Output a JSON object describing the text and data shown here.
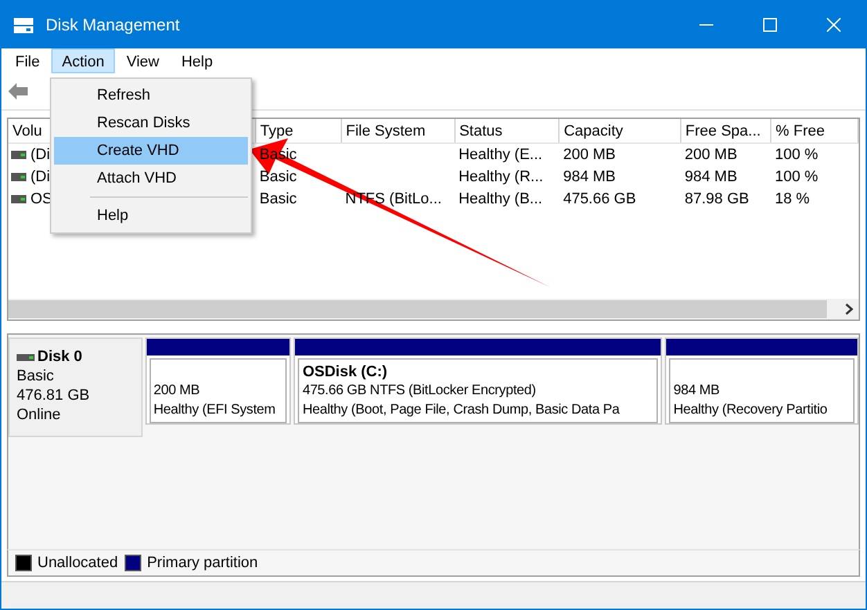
{
  "window": {
    "title": "Disk Management"
  },
  "menu_bar": [
    {
      "label": "File",
      "selected": false
    },
    {
      "label": "Action",
      "selected": true
    },
    {
      "label": "View",
      "selected": false
    },
    {
      "label": "Help",
      "selected": false
    }
  ],
  "dropdown": {
    "items": [
      {
        "label": "Refresh",
        "selected": false,
        "separator_before": false
      },
      {
        "label": "Rescan Disks",
        "selected": false,
        "separator_before": false
      },
      {
        "label": "Create VHD",
        "selected": true,
        "separator_before": false
      },
      {
        "label": "Attach VHD",
        "selected": false,
        "separator_before": false
      },
      {
        "label": "Help",
        "selected": false,
        "separator_before": true
      }
    ]
  },
  "table": {
    "columns": [
      "Volu",
      "",
      "Type",
      "File System",
      "Status",
      "Capacity",
      "Free Spa...",
      "% Free"
    ],
    "rows": [
      [
        "(Di",
        "",
        "Basic",
        "",
        "Healthy (E...",
        "200 MB",
        "200 MB",
        "100 %"
      ],
      [
        "(Di",
        "",
        "Basic",
        "",
        "Healthy (R...",
        "984 MB",
        "984 MB",
        "100 %"
      ],
      [
        "OS",
        "",
        "Basic",
        "NTFS (BitLo...",
        "Healthy (B...",
        "475.66 GB",
        "87.98 GB",
        "18 %"
      ]
    ]
  },
  "disk": {
    "name": "Disk 0",
    "lines": [
      "Basic",
      "476.81 GB",
      "Online"
    ],
    "partitions": [
      {
        "lines": [
          "200 MB",
          "Healthy (EFI System"
        ]
      },
      {
        "title": "OSDisk  (C:)",
        "lines": [
          "475.66 GB NTFS (BitLocker Encrypted)",
          "Healthy (Boot, Page File, Crash Dump, Basic Data Pa"
        ]
      },
      {
        "lines": [
          "984 MB",
          "Healthy (Recovery Partitio"
        ]
      }
    ]
  },
  "legend": [
    {
      "label": "Unallocated",
      "color": "#000000"
    },
    {
      "label": "Primary partition",
      "color": "#000080"
    }
  ]
}
